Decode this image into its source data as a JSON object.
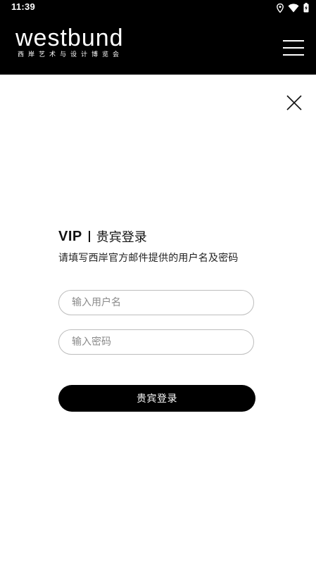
{
  "status_bar": {
    "time": "11:39",
    "icons": [
      "location-icon",
      "wifi-icon",
      "battery-icon"
    ]
  },
  "header": {
    "brand_title": "westbund",
    "brand_subtitle": "西岸艺术与设计博览会",
    "menu_icon": "hamburger-menu-icon"
  },
  "close_icon": "close-icon",
  "login": {
    "vip_label": "VIP",
    "title": "贵宾登录",
    "instruction": "请填写西岸官方邮件提供的用户名及密码",
    "username": {
      "value": "",
      "placeholder": "输入用户名"
    },
    "password": {
      "value": "",
      "placeholder": "输入密码"
    },
    "submit_label": "贵宾登录"
  },
  "colors": {
    "header_bg": "#000000",
    "page_bg": "#ffffff",
    "button_bg": "#000000",
    "button_text": "#ffffff",
    "field_border": "#bdbdbd",
    "placeholder_text": "#8a8a8a"
  }
}
